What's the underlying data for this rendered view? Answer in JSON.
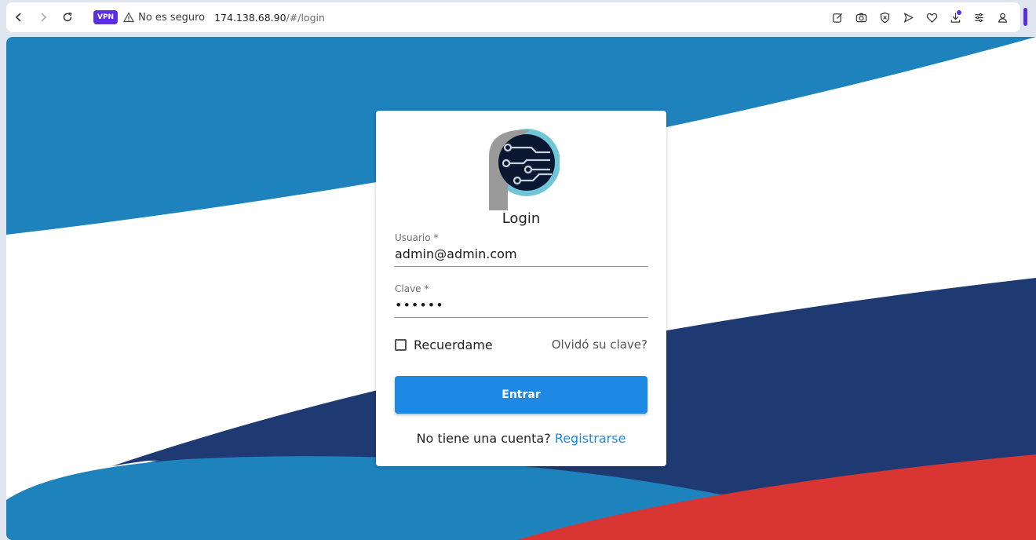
{
  "browser": {
    "vpn_label": "VPN",
    "security_text": "No es seguro",
    "url_host": "174.138.68.90",
    "url_path": "/#/login",
    "toolbar_icons": [
      "edit-icon",
      "camera-icon",
      "shield-icon",
      "send-icon",
      "heart-icon",
      "download-icon",
      "menu-icon",
      "profile-icon"
    ]
  },
  "login": {
    "title": "Login",
    "username_label": "Usuario *",
    "username_value": "admin@admin.com",
    "password_label": "Clave *",
    "password_value": "••••••",
    "remember_label": "Recuerdame",
    "forgot_label": "Olvidó su clave?",
    "submit_label": "Entrar",
    "signup_prompt": "No tiene una cuenta?",
    "signup_link": "Registrarse"
  },
  "colors": {
    "accent": "#1e88e5",
    "wave_light_blue": "#1e82bd",
    "wave_dark_blue": "#1f3a72",
    "wave_red": "#d93532",
    "vpn": "#5b2fe0"
  }
}
